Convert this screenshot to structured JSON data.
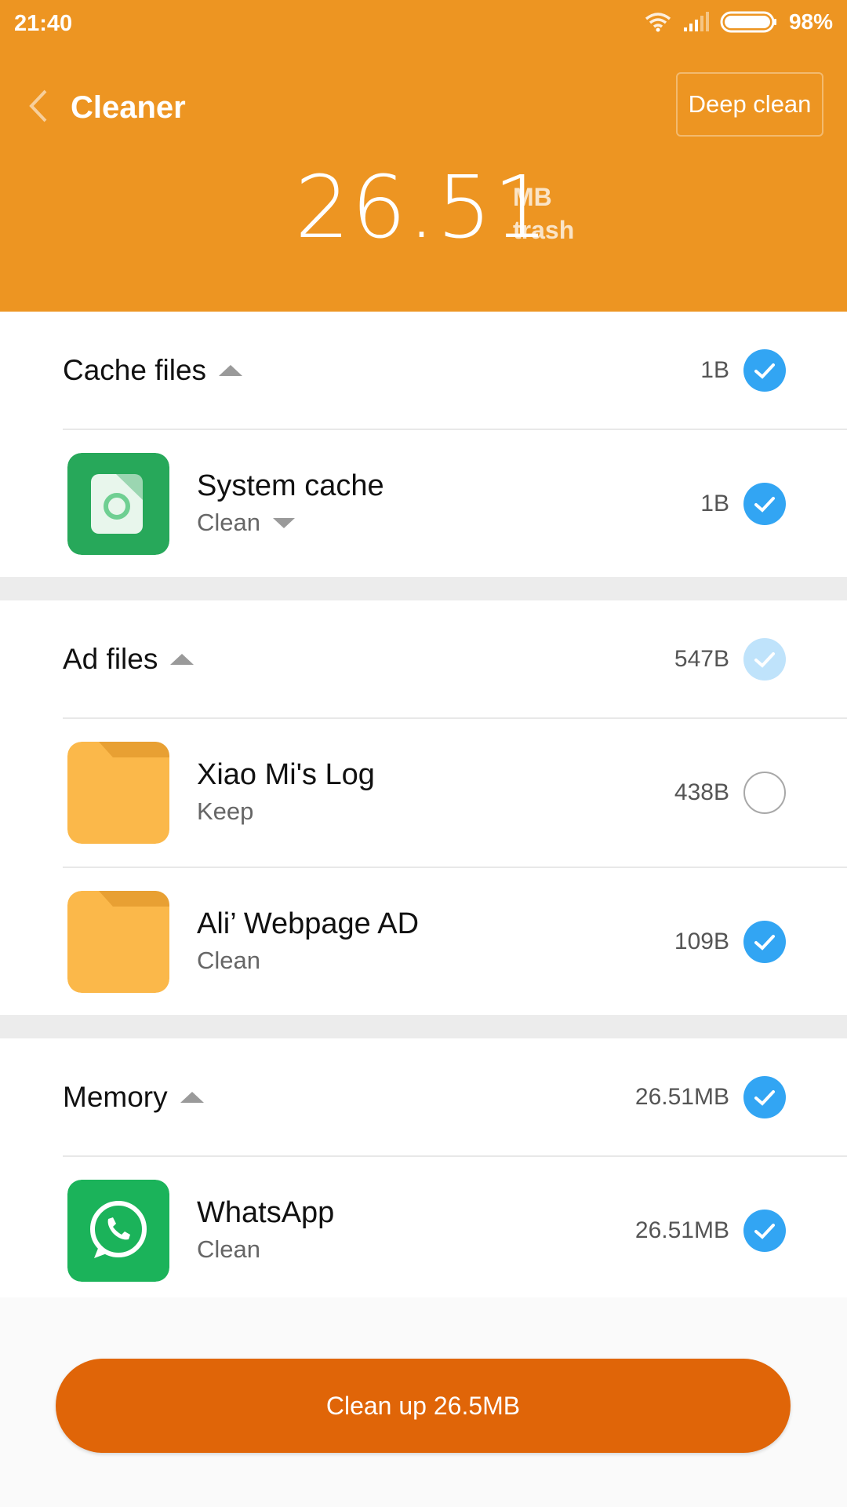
{
  "status": {
    "time": "21:40",
    "battery": "98%"
  },
  "header": {
    "title": "Cleaner",
    "deep_clean": "Deep clean",
    "total_value": "26.51",
    "total_unit": "MB",
    "total_label": "trash"
  },
  "sections": {
    "cache": {
      "title": "Cache files",
      "size": "1B",
      "check": "checked",
      "items": [
        {
          "name": "System cache",
          "action": "Clean",
          "size": "1B",
          "check": "checked",
          "icon": "system-cache-icon"
        }
      ]
    },
    "ads": {
      "title": "Ad files",
      "size": "547B",
      "check": "partial",
      "items": [
        {
          "name": "Xiao Mi's Log",
          "action": "Keep",
          "size": "438B",
          "check": "unchecked",
          "icon": "folder-icon"
        },
        {
          "name": "Ali’ Webpage AD",
          "action": "Clean",
          "size": "109B",
          "check": "checked",
          "icon": "folder-icon"
        }
      ]
    },
    "memory": {
      "title": "Memory",
      "size": "26.51MB",
      "check": "checked",
      "items": [
        {
          "name": "WhatsApp",
          "action": "Clean",
          "size": "26.51MB",
          "check": "checked",
          "icon": "whatsapp-icon"
        }
      ]
    }
  },
  "footer": {
    "button_label": "Clean up 26.5MB"
  },
  "colors": {
    "header": "#ed9522",
    "accent": "#32a5f3",
    "button": "#e06508",
    "folder": "#fbb84a"
  }
}
